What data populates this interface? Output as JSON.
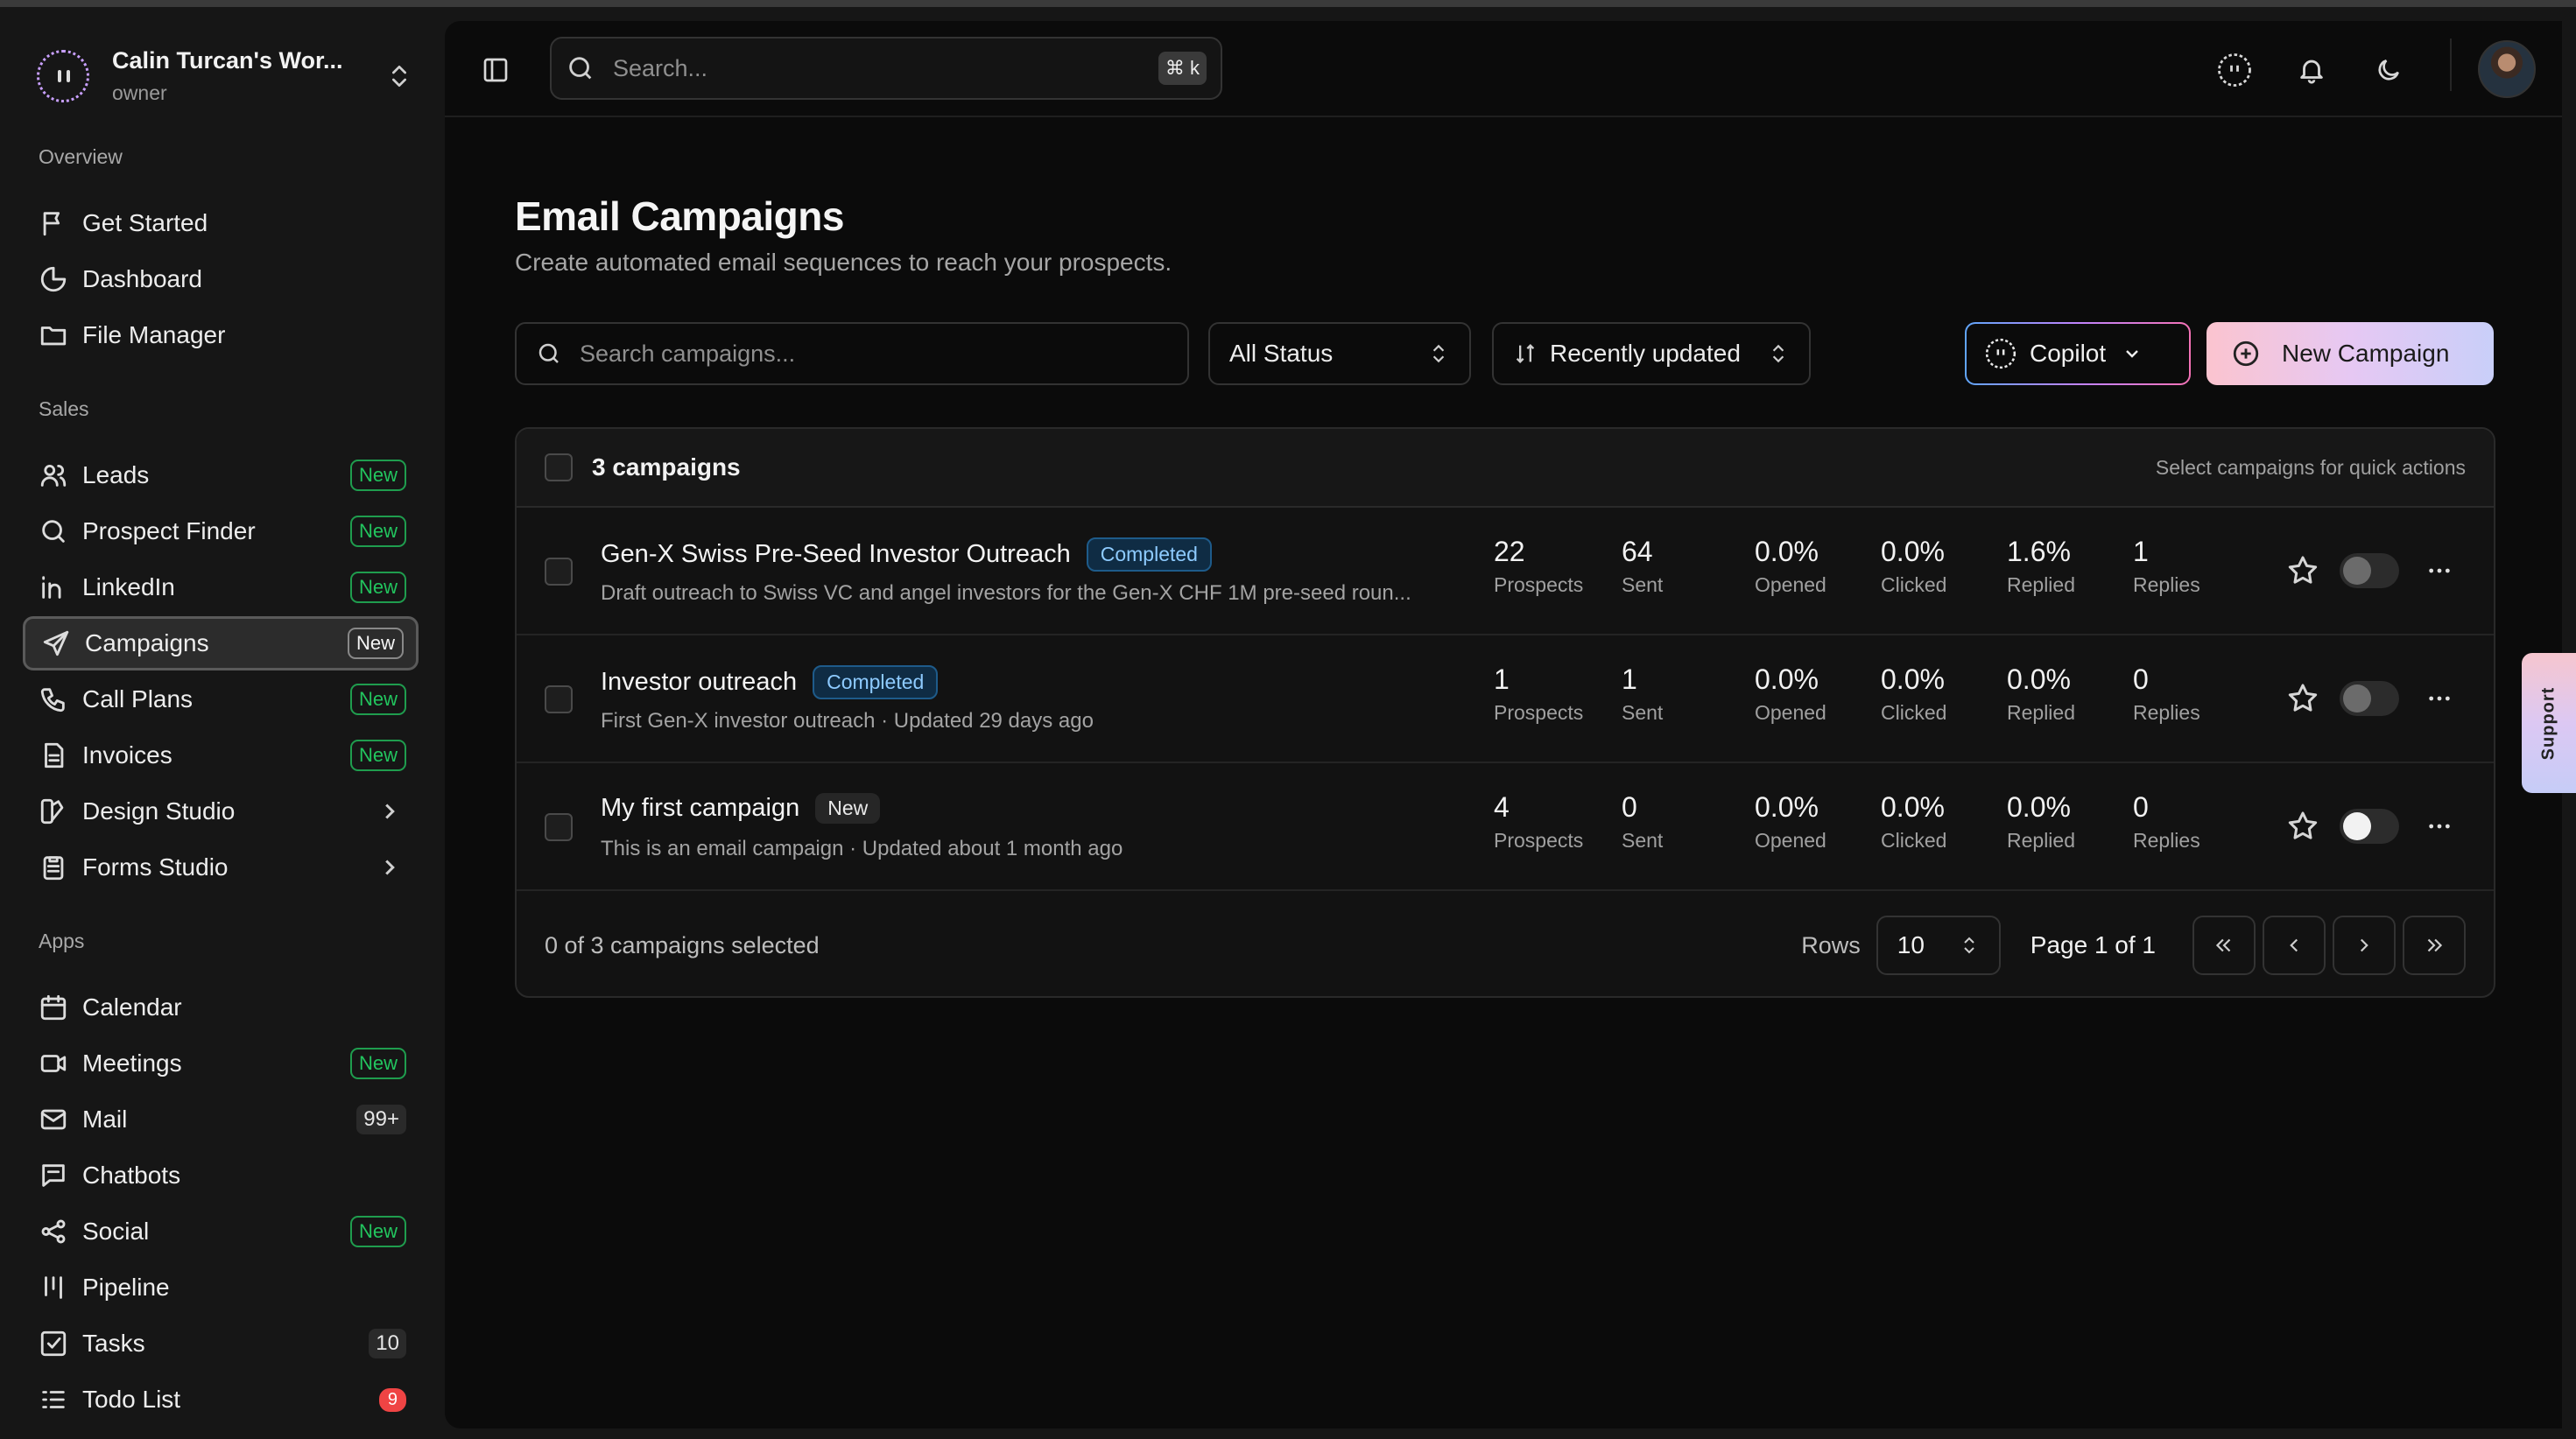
{
  "workspace": {
    "name": "Calin Turcan's Wor...",
    "role": "owner"
  },
  "sidebar": {
    "overview_label": "Overview",
    "sales_label": "Sales",
    "apps_label": "Apps",
    "overview": [
      {
        "label": "Get Started",
        "icon": "flag-icon"
      },
      {
        "label": "Dashboard",
        "icon": "pie-chart-icon"
      },
      {
        "label": "File Manager",
        "icon": "folder-icon"
      }
    ],
    "sales": [
      {
        "label": "Leads",
        "icon": "users-icon",
        "badge": "New"
      },
      {
        "label": "Prospect Finder",
        "icon": "search-icon",
        "badge": "New"
      },
      {
        "label": "LinkedIn",
        "icon": "linkedin-icon",
        "badge": "New"
      },
      {
        "label": "Campaigns",
        "icon": "send-icon",
        "badge": "New",
        "active": true
      },
      {
        "label": "Call Plans",
        "icon": "phone-icon",
        "badge": "New"
      },
      {
        "label": "Invoices",
        "icon": "file-text-icon",
        "badge": "New"
      },
      {
        "label": "Design Studio",
        "icon": "palette-icon"
      },
      {
        "label": "Forms Studio",
        "icon": "clipboard-icon"
      }
    ],
    "apps": [
      {
        "label": "Calendar",
        "icon": "calendar-icon"
      },
      {
        "label": "Meetings",
        "icon": "video-icon",
        "badge": "New"
      },
      {
        "label": "Mail",
        "icon": "mail-icon",
        "count": "99+"
      },
      {
        "label": "Chatbots",
        "icon": "message-icon"
      },
      {
        "label": "Social",
        "icon": "share-icon",
        "badge": "New"
      },
      {
        "label": "Pipeline",
        "icon": "kanban-icon"
      },
      {
        "label": "Tasks",
        "icon": "check-square-icon",
        "count": "10"
      },
      {
        "label": "Todo List",
        "icon": "list-icon",
        "count": "9"
      }
    ]
  },
  "topbar": {
    "search_placeholder": "Search...",
    "shortcut": "⌘ k"
  },
  "page": {
    "title": "Email Campaigns",
    "subtitle": "Create automated email sequences to reach your prospects."
  },
  "filters": {
    "search_placeholder": "Search campaigns...",
    "status": "All Status",
    "sort": "Recently updated",
    "copilot": "Copilot",
    "new_campaign": "New Campaign"
  },
  "table": {
    "count_label": "3 campaigns",
    "hint": "Select campaigns for quick actions",
    "stat_labels": [
      "Prospects",
      "Sent",
      "Opened",
      "Clicked",
      "Replied",
      "Replies"
    ],
    "rows": [
      {
        "name": "Gen-X Swiss Pre-Seed Investor Outreach",
        "status": "Completed",
        "description": "Draft outreach to Swiss VC and angel investors for the Gen-X CHF 1M pre-seed roun...",
        "stats": [
          "22",
          "64",
          "0.0%",
          "0.0%",
          "1.6%",
          "1"
        ],
        "enabled": false
      },
      {
        "name": "Investor outreach",
        "status": "Completed",
        "description": "First Gen-X investor outreach · Updated 29 days ago",
        "stats": [
          "1",
          "1",
          "0.0%",
          "0.0%",
          "0.0%",
          "0"
        ],
        "enabled": false
      },
      {
        "name": "My first campaign",
        "status": "New",
        "description": "This is an email campaign · Updated about 1 month ago",
        "stats": [
          "4",
          "0",
          "0.0%",
          "0.0%",
          "0.0%",
          "0"
        ],
        "enabled": true
      }
    ],
    "footer": {
      "selected": "0 of 3 campaigns selected",
      "rows_label": "Rows",
      "rows_value": "10",
      "page": "Page 1 of 1"
    }
  },
  "support_label": "Support"
}
